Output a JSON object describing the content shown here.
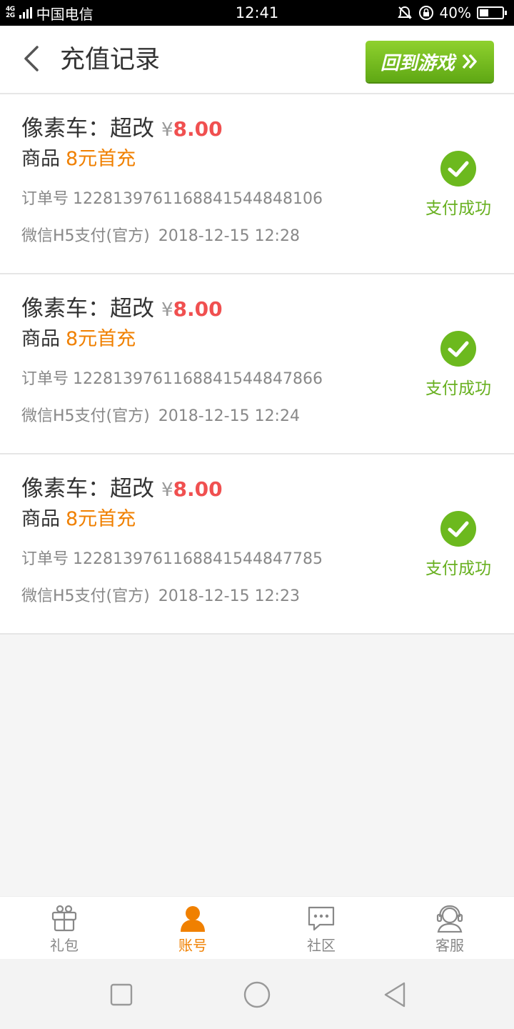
{
  "status_bar": {
    "network": "4G\n2G",
    "carrier": "中国电信",
    "time": "12:41",
    "battery": "40%",
    "battery_level": 0.4
  },
  "header": {
    "title": "充值记录",
    "return_button": "回到游戏"
  },
  "colors": {
    "accent_orange": "#f08000",
    "price_red": "#f05050",
    "success_green": "#68b020"
  },
  "records": [
    {
      "game": "像素车：超改",
      "currency": "¥",
      "amount": "8.00",
      "product_label": "商品",
      "product_name": "8元首充",
      "order_label": "订单号",
      "order_number": "1228139761168841544848106",
      "payment_method": "微信H5支付(官方)",
      "datetime": "2018-12-15 12:28",
      "status": "支付成功"
    },
    {
      "game": "像素车：超改",
      "currency": "¥",
      "amount": "8.00",
      "product_label": "商品",
      "product_name": "8元首充",
      "order_label": "订单号",
      "order_number": "1228139761168841544847866",
      "payment_method": "微信H5支付(官方)",
      "datetime": "2018-12-15 12:24",
      "status": "支付成功"
    },
    {
      "game": "像素车：超改",
      "currency": "¥",
      "amount": "8.00",
      "product_label": "商品",
      "product_name": "8元首充",
      "order_label": "订单号",
      "order_number": "1228139761168841544847785",
      "payment_method": "微信H5支付(官方)",
      "datetime": "2018-12-15 12:23",
      "status": "支付成功"
    }
  ],
  "tabs": [
    {
      "label": "礼包",
      "icon": "gift-icon",
      "active": false
    },
    {
      "label": "账号",
      "icon": "account-icon",
      "active": true
    },
    {
      "label": "社区",
      "icon": "chat-bubble-icon",
      "active": false
    },
    {
      "label": "客服",
      "icon": "headset-icon",
      "active": false
    }
  ]
}
